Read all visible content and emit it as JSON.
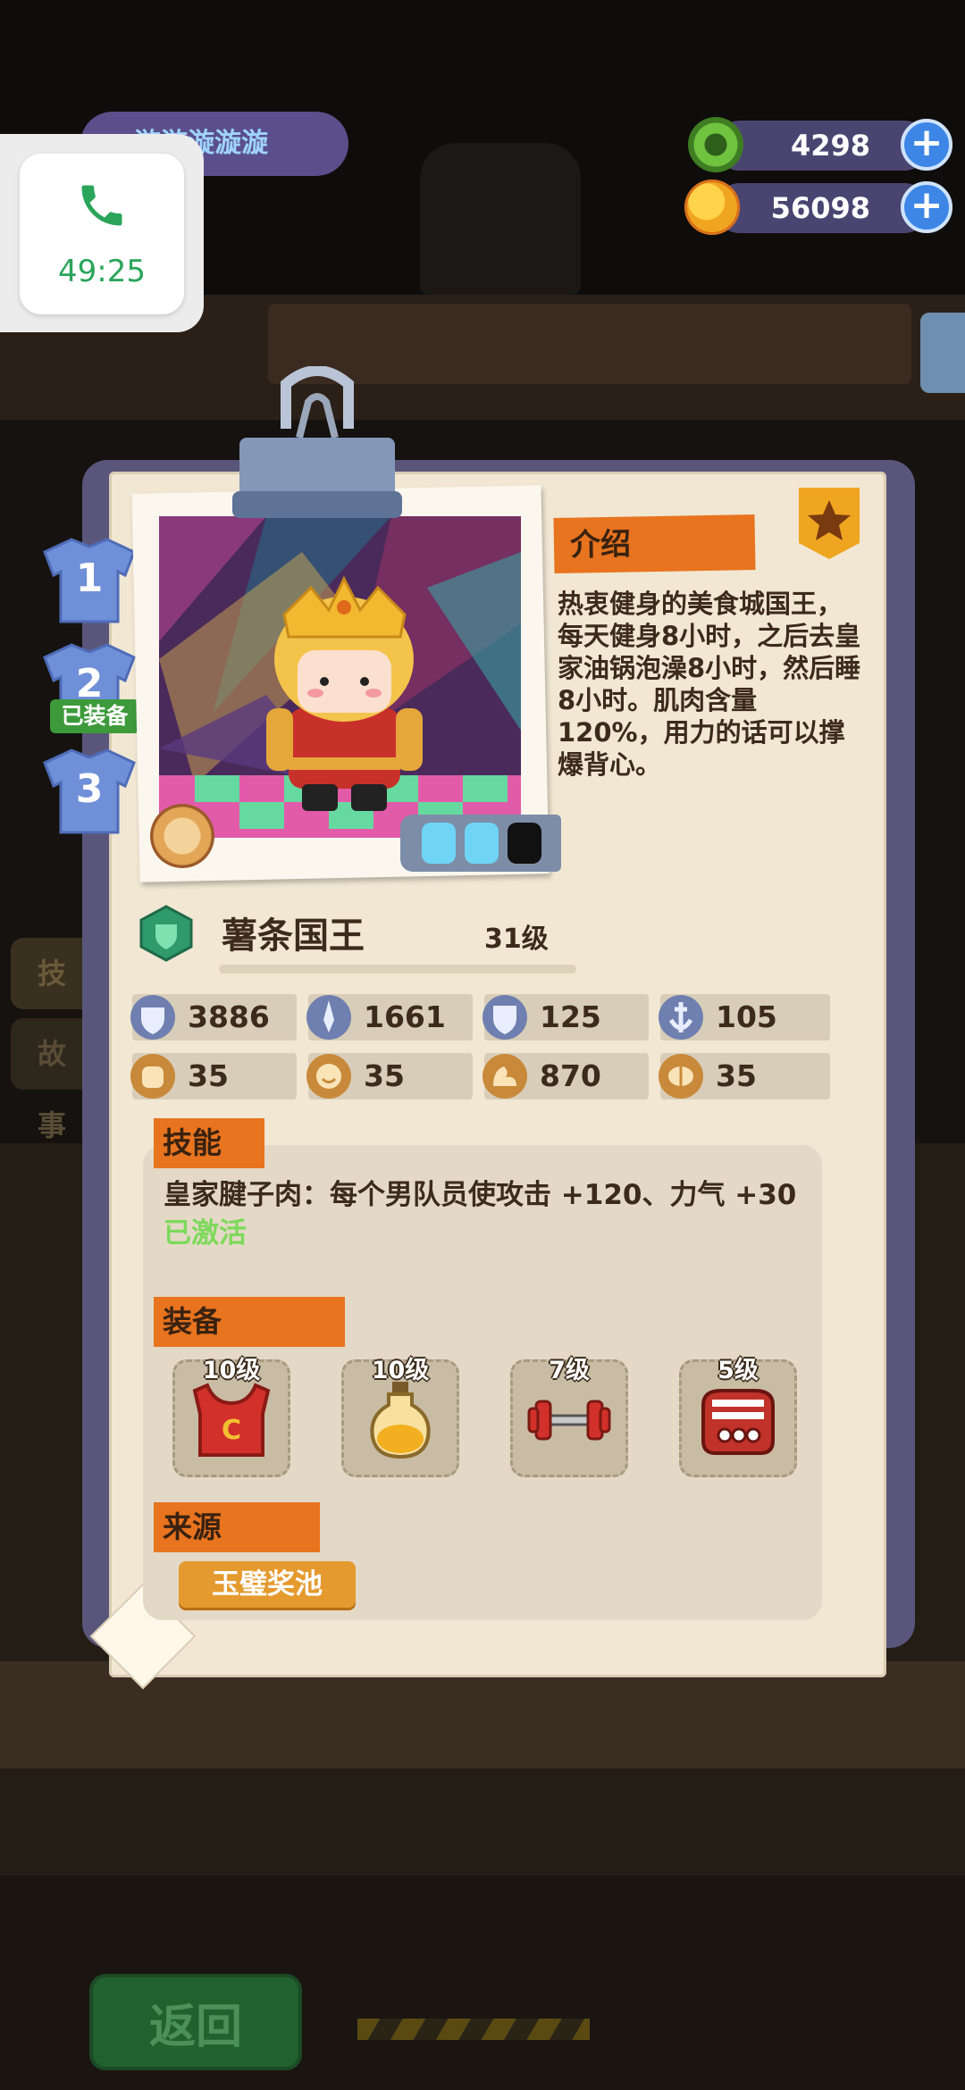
{
  "player": {
    "name": "漩漩漩漩漩"
  },
  "call": {
    "timer": "49:25"
  },
  "currencies": [
    {
      "name": "donut",
      "amount": "4298",
      "icon": "donut-coin-icon",
      "color": "#5fae34"
    },
    {
      "name": "planet",
      "amount": "56098",
      "icon": "planet-coin-icon",
      "color": "#f0a520"
    }
  ],
  "background": {
    "return_label": "返回",
    "side_tabs": [
      "技能",
      "故事"
    ]
  },
  "outfits": {
    "tabs": [
      "1",
      "2",
      "3"
    ],
    "equipped_badge": "已装备"
  },
  "hero": {
    "name": "薯条国王",
    "level": "31级",
    "energy_slots": [
      "filled",
      "filled",
      "empty"
    ],
    "rarity_color": "#2f9a6a"
  },
  "intro": {
    "label": "介绍",
    "text": "热衷健身的美食城国王，每天健身8小时，之后去皇家油锅泡澡8小时，然后睡8小时。肌肉含量120%，用力的话可以撑爆背心。"
  },
  "stats": [
    {
      "icon": "heart-shield-icon",
      "value": "3886"
    },
    {
      "icon": "sword-icon",
      "value": "1661"
    },
    {
      "icon": "shield-icon",
      "value": "125"
    },
    {
      "icon": "anchor-shield-icon",
      "value": "105"
    },
    {
      "icon": "fist-icon",
      "value": "35"
    },
    {
      "icon": "smile-icon",
      "value": "35"
    },
    {
      "icon": "muscle-icon",
      "value": "870"
    },
    {
      "icon": "brain-icon",
      "value": "35"
    }
  ],
  "skill": {
    "label": "技能",
    "description": "皇家腱子肉：每个男队员使攻击 +120、力气 +30",
    "status": "已激活"
  },
  "equipment": {
    "label": "装备",
    "items": [
      {
        "icon": "tank-top-icon",
        "level": "10级"
      },
      {
        "icon": "oil-bottle-icon",
        "level": "10级"
      },
      {
        "icon": "dumbbell-icon",
        "level": "7级"
      },
      {
        "icon": "scale-machine-icon",
        "level": "5级"
      }
    ]
  },
  "source": {
    "label": "来源",
    "value": "玉璧奖池"
  }
}
